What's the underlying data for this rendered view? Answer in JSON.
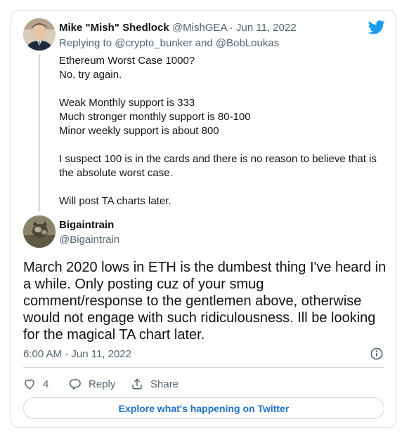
{
  "tweet1": {
    "name": "Mike \"Mish\" Shedlock",
    "handle": "@MishGEA",
    "separator": "·",
    "date": "Jun 11, 2022",
    "reply_prefix": "Replying to",
    "reply_user1": "@crypto_bunker",
    "reply_and": "and",
    "reply_user2": "@BobLoukas",
    "lines": [
      "Ethereum Worst Case 1000?",
      "No, try again.",
      "Weak Monthly support is 333",
      "Much stronger monthly support is 80-100",
      "Minor weekly support is about 800",
      "I suspect 100 is in the cards and there is no reason to believe that is the absolute worst case.",
      "Will post TA charts later."
    ]
  },
  "tweet2": {
    "name": "Bigaintrain",
    "handle": "@Bigaintrain",
    "text": "March 2020 lows in ETH is the dumbest thing I've heard in a while. Only posting cuz of your smug comment/response to the gentlemen above, otherwise would not engage with such ridiculousness. Ill be looking for the magical TA chart later.",
    "timestamp": "6:00 AM · Jun 11, 2022"
  },
  "actions": {
    "likes": "4",
    "reply_label": "Reply",
    "share_label": "Share"
  },
  "explore_label": "Explore what's happening on Twitter",
  "colors": {
    "twitter_blue": "#1d9bf0",
    "link_blue": "#1d72c4",
    "muted_text": "#536471",
    "border": "#cfd9de"
  },
  "icons": [
    "twitter-bird-icon",
    "info-icon",
    "heart-icon",
    "reply-icon",
    "share-icon"
  ]
}
